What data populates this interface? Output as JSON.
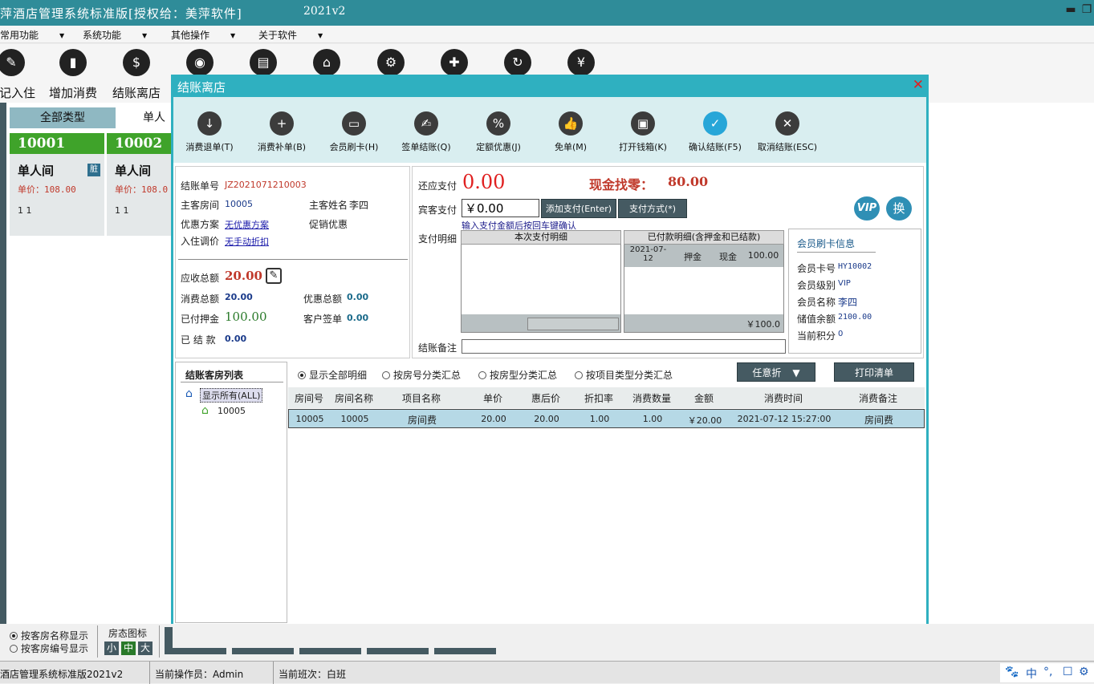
{
  "app": {
    "title": "萍酒店管理系统标准版[授权给：美萍软件]",
    "version": "2021v2",
    "minimize_glyph": "▬",
    "restore_glyph": "❐"
  },
  "menu": [
    {
      "label": "常用功能"
    },
    {
      "label": "系统功能"
    },
    {
      "label": "其他操作"
    },
    {
      "label": "关于软件"
    }
  ],
  "menu_arrow": "▼",
  "toolbar": [
    {
      "label": "登记入住",
      "icon": "edit-icon",
      "glyph": "✎"
    },
    {
      "label": "增加消费",
      "icon": "bottle-icon",
      "glyph": "▮"
    },
    {
      "label": "结账离店",
      "icon": "receipt-icon",
      "glyph": "$"
    },
    {
      "label": "",
      "icon": "open-sign-icon",
      "glyph": "◉"
    },
    {
      "label": "",
      "icon": "printer-icon",
      "glyph": "▤"
    },
    {
      "label": "",
      "icon": "bank-icon",
      "glyph": "⌂"
    },
    {
      "label": "",
      "icon": "gear-icon",
      "glyph": "⚙"
    },
    {
      "label": "",
      "icon": "user-add-icon",
      "glyph": "✚"
    },
    {
      "label": "",
      "icon": "refresh-icon",
      "glyph": "↻"
    },
    {
      "label": "",
      "icon": "yen-search-icon",
      "glyph": "¥"
    }
  ],
  "room_panel": {
    "tabs": [
      {
        "label": "全部类型"
      },
      {
        "label": "单人"
      }
    ],
    "rooms": [
      {
        "number": "10001",
        "type": "单人间",
        "price": "单价：108.00",
        "misc": "1 1",
        "dirty": "脏"
      },
      {
        "number": "10002",
        "type": "单人间",
        "price": "单价：108.0",
        "misc": "1 1",
        "dirty": ""
      }
    ]
  },
  "dialog": {
    "title": "结账离店",
    "close_glyph": "✕",
    "tools": [
      {
        "label": "消费退单(T)",
        "icon": "download-icon",
        "glyph": "↓",
        "active": false
      },
      {
        "label": "消费补单(B)",
        "icon": "plus-icon",
        "glyph": "+",
        "active": false
      },
      {
        "label": "会员刷卡(H)",
        "icon": "card-icon",
        "glyph": "▭",
        "active": false
      },
      {
        "label": "签单结账(Q)",
        "icon": "sign-icon",
        "glyph": "✍",
        "active": false
      },
      {
        "label": "定额优惠(J)",
        "icon": "percent-icon",
        "glyph": "%",
        "active": false
      },
      {
        "label": "免单(M)",
        "icon": "thumb-up-icon",
        "glyph": "👍",
        "active": false
      },
      {
        "label": "打开钱箱(K)",
        "icon": "wallet-icon",
        "glyph": "▣",
        "active": false
      },
      {
        "label": "确认结账(F5)",
        "icon": "confirm-check-icon",
        "glyph": "✓",
        "active": true
      },
      {
        "label": "取消结账(ESC)",
        "icon": "cancel-icon",
        "glyph": "✕",
        "active": false
      }
    ],
    "info": {
      "bill_no_label": "结账单号",
      "bill_no": "JZ2021071210003",
      "room_label": "主客房间",
      "room": "10005",
      "guest_label": "主客姓名",
      "guest": "李四",
      "discount_label": "优惠方案",
      "discount": "无优惠方案",
      "promo_label": "促销优惠",
      "adjust_label": "入住调价",
      "adjust": "无手动折扣",
      "receivable_label": "应收总额",
      "receivable": "20.00",
      "consume_label": "消费总额",
      "consume": "20.00",
      "discount_total_label": "优惠总额",
      "discount_total": "0.00",
      "deposit_label": "已付押金",
      "deposit": "100.00",
      "sign_label": "客户签单",
      "sign": "0.00",
      "settled_label": "已 结 款",
      "settled": "0.00"
    },
    "payment": {
      "due_label": "还应支付",
      "due": "0.00",
      "change_label": "现金找零：",
      "change": "80.00",
      "guest_pay_label": "宾客支付",
      "guest_pay_value": "￥0.00",
      "add_pay_button": "添加支付(Enter)",
      "pay_method_button": "支付方式(*)",
      "hint": "输入支付金额后按回车键确认",
      "detail_label": "支付明细",
      "this_detail_header": "本次支付明细",
      "paid_header": "已付款明细(含押金和已结款)",
      "paid_row": {
        "date": "2021-07-12",
        "type": "押金",
        "method": "现金",
        "amount": "100.00"
      },
      "paid_total": "￥100.0",
      "remark_label": "结账备注"
    },
    "vip_badge": "VIP",
    "swap_badge": "换",
    "member": {
      "title": "会员刷卡信息",
      "card_label": "会员卡号",
      "card": "HY10002",
      "level_label": "会员级别",
      "level": "VIP",
      "name_label": "会员名称",
      "name": "李四",
      "balance_label": "储值余额",
      "balance": "2100.00",
      "points_label": "当前积分",
      "points": "0"
    },
    "room_list": {
      "title": "结账客房列表",
      "all": "显示所有(ALL)",
      "room": "10005"
    },
    "filters": [
      {
        "label": "显示全部明细",
        "checked": true
      },
      {
        "label": "按房号分类汇总",
        "checked": false
      },
      {
        "label": "按房型分类汇总",
        "checked": false
      },
      {
        "label": "按项目类型分类汇总",
        "checked": false
      }
    ],
    "discount_button": "任意折",
    "print_button": "打印清单",
    "table": {
      "columns": [
        "房间号",
        "房间名称",
        "项目名称",
        "单价",
        "惠后价",
        "折扣率",
        "消费数量",
        "金额",
        "消费时间",
        "消费备注"
      ],
      "rows": [
        [
          "10005",
          "10005",
          "房间费",
          "20.00",
          "20.00",
          "1.00",
          "1.00",
          "￥20.00",
          "2021-07-12 15:27:00",
          "房间费"
        ]
      ]
    }
  },
  "bottom": {
    "radio1": "按客房名称显示",
    "radio2": "按客房编号显示",
    "icon_label": "房态图标",
    "sizes": [
      "小",
      "中",
      "大"
    ]
  },
  "status": {
    "app": "酒店管理系统标准版2021v2",
    "operator": "当前操作员：Admin",
    "shift": "当前班次：白班",
    "tray": [
      "🐾",
      "中",
      "°,",
      "☐",
      "⚙"
    ]
  }
}
